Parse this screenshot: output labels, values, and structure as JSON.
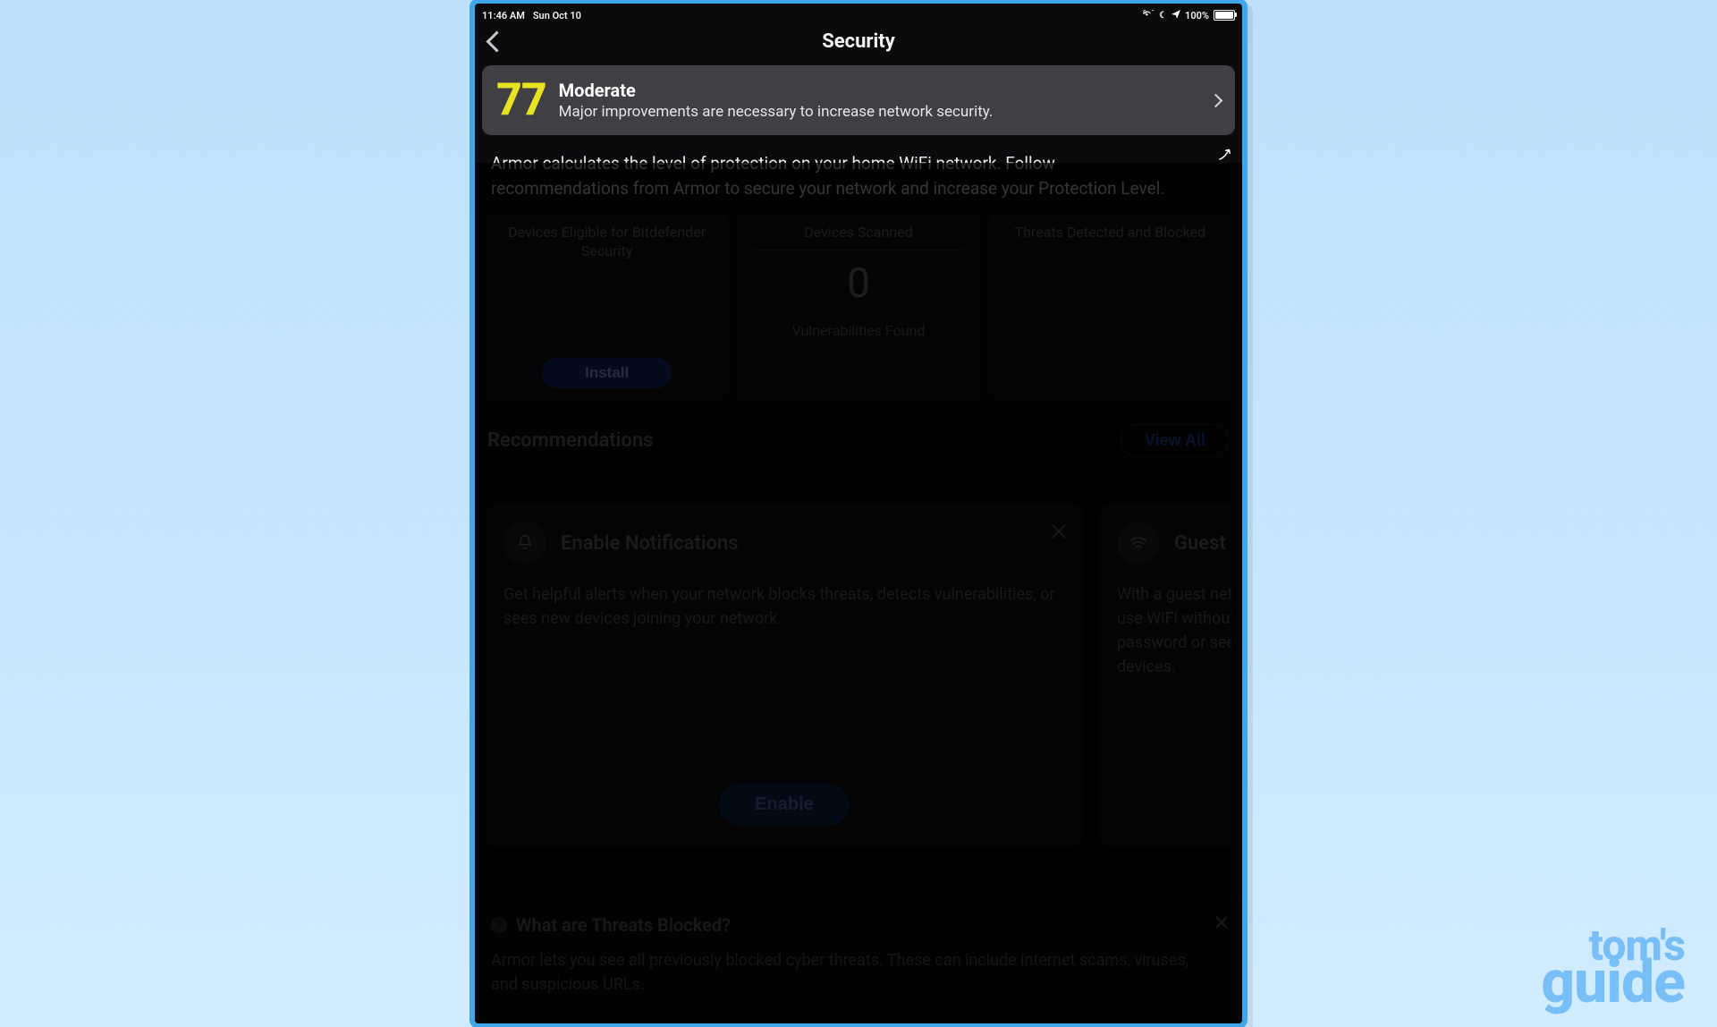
{
  "statusbar": {
    "time": "11:46 AM",
    "date": "Sun Oct 10",
    "battery_pct": "100%"
  },
  "nav": {
    "title": "Security"
  },
  "banner": {
    "score": "77",
    "level": "Moderate",
    "subtitle": "Major improvements are necessary to increase network security."
  },
  "description": "Armor calculates the level of protection on your home WiFi network. Follow recommendations from Armor to secure your network and increase your Protection Level.",
  "tiles": {
    "eligible": {
      "title": "Devices Eligible for Bitdefender Security",
      "button": "Install"
    },
    "scanned": {
      "title": "Devices Scanned",
      "value": "0",
      "sub": "Vulnerabilities Found"
    },
    "threats": {
      "title": "Threats Detected and Blocked"
    }
  },
  "recommendations": {
    "heading": "Recommendations",
    "view_all": "View All",
    "cards": [
      {
        "title": "Enable Notifications",
        "body": "Get helpful alerts when your network blocks threats, detects vulnerabilities, or sees new devices joining your network.",
        "cta": "Enable"
      },
      {
        "title": "Guest WiFi Network",
        "body": "With a guest network, visitors can use WiFi without sharing your main password or seeing your connected devices."
      }
    ]
  },
  "info": {
    "question": "What are Threats Blocked?",
    "body": "Armor lets you see all previously blocked cyber threats. These can include internet scams, viruses, and suspicious URLs."
  },
  "watermark": {
    "line1": "tom's",
    "line2": "guide"
  }
}
